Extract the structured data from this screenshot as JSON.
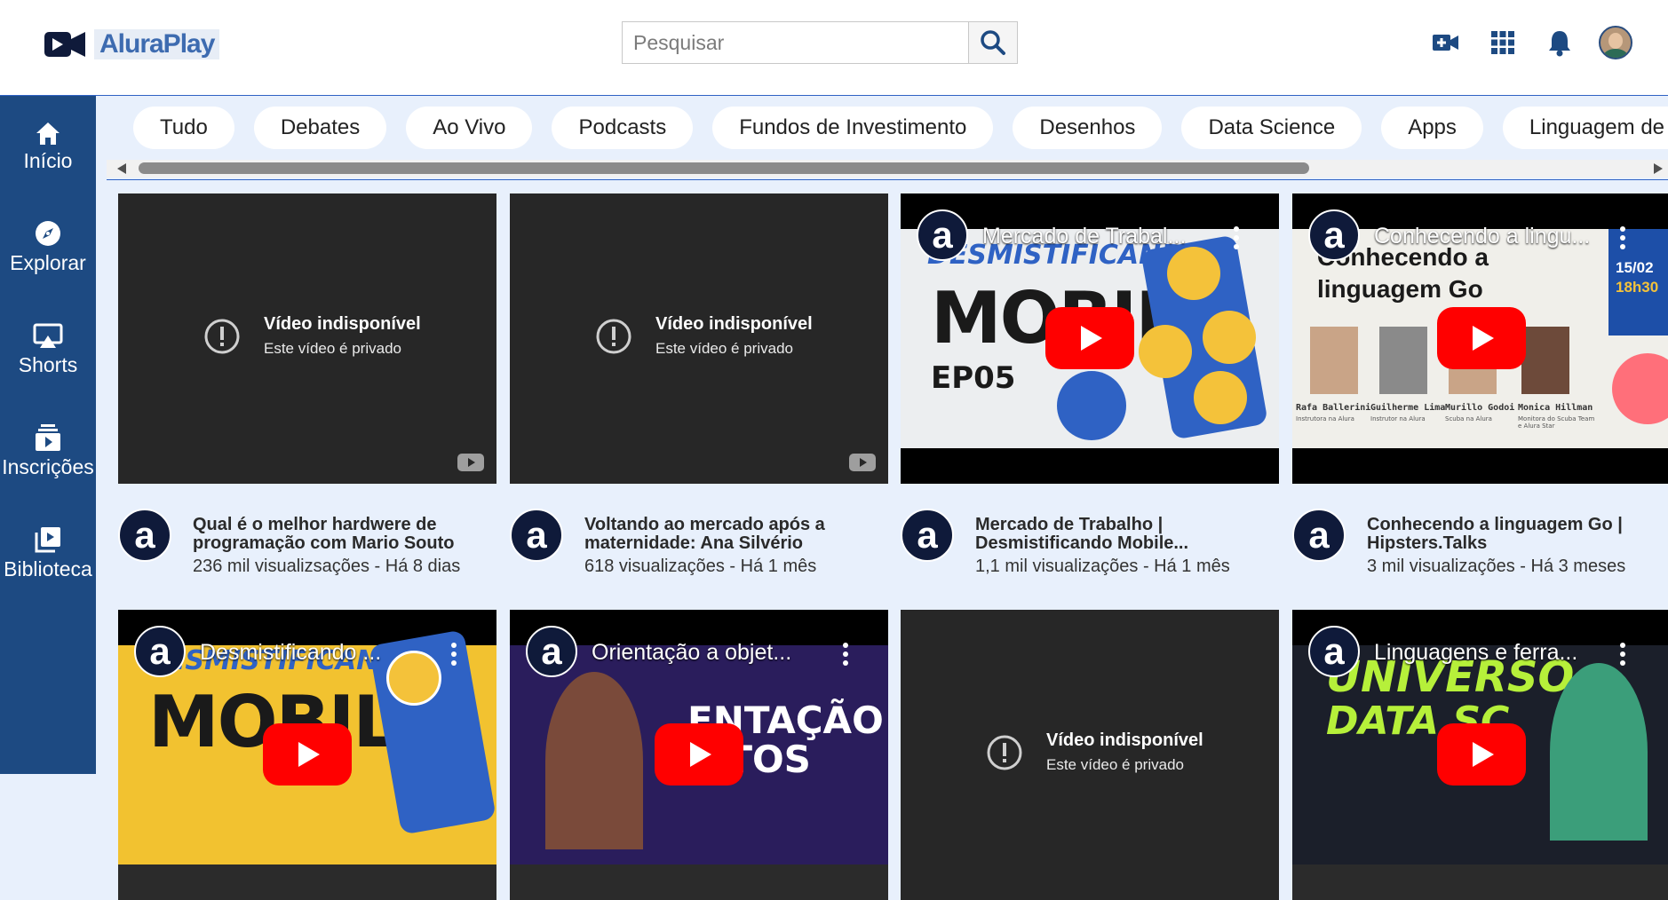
{
  "app": {
    "name": "AluraPlay"
  },
  "search": {
    "placeholder": "Pesquisar"
  },
  "sidebar": {
    "items": [
      {
        "label": "Início",
        "icon": "home-icon"
      },
      {
        "label": "Explorar",
        "icon": "compass-icon"
      },
      {
        "label": "Shorts",
        "icon": "shorts-icon"
      },
      {
        "label": "Inscrições",
        "icon": "subscriptions-icon"
      },
      {
        "label": "Biblioteca",
        "icon": "library-icon"
      }
    ]
  },
  "header_icons": [
    "add-video-icon",
    "apps-grid-icon",
    "bell-icon",
    "avatar"
  ],
  "chips": [
    "Tudo",
    "Debates",
    "Ao Vivo",
    "Podcasts",
    "Fundos de Investimento",
    "Desenhos",
    "Data Science",
    "Apps",
    "Linguagem de"
  ],
  "colors": {
    "sidebar": "#1d4a82",
    "accent": "#2f62c4",
    "background": "#e8f0fc",
    "play": "#ff0000"
  },
  "unavailable": {
    "title": "Vídeo indisponível",
    "subtitle": "Este vídeo é privado"
  },
  "videos": [
    {
      "title": "Qual é o melhor hardwere de programação com Mario Souto",
      "stats": "236 mil visualizsações - Há 8 dias",
      "state": "unavailable"
    },
    {
      "title": "Voltando ao mercado após a maternidade: Ana Silvério",
      "stats": "618 visualizações - Há 1 mês",
      "state": "unavailable"
    },
    {
      "title": "Mercado de Trabalho | Desmistificando Mobile...",
      "stats": "1,1 mil visualizações - Há 1 mês",
      "embed_title": "Mercado de Trabal...",
      "art": [
        "DESMISTIFICANDO",
        "MOBILE",
        "EP05"
      ]
    },
    {
      "title": "Conhecendo a linguagem Go | Hipsters.Talks",
      "stats": "3 mil visualizações - Há 3 meses",
      "embed_title": "Conhecendo a lingu...",
      "art": [
        "Conhecendo a",
        "linguagem Go",
        "15/02",
        "18h30"
      ],
      "people": [
        "Rafa Ballerini",
        "Guilherme Lima",
        "Murillo Godoi",
        "Monica Hillman"
      ],
      "roles": [
        "Instrutora na Alura",
        "Instrutor na Alura",
        "Scuba na Alura",
        "Monitora do Scuba Team e Alura Star"
      ]
    }
  ],
  "videos_row2": [
    {
      "embed_title": "Desmistificando ...",
      "art": [
        "DESMISTIFICANDO",
        "MOBILE"
      ]
    },
    {
      "embed_title": "Orientação a objet...",
      "art": [
        "ENTAÇÃO",
        "JETOS"
      ]
    },
    {
      "state": "unavailable"
    },
    {
      "embed_title": "Linguagens e ferra...",
      "art": [
        "UNIVERSO",
        "DATA SC"
      ]
    }
  ]
}
